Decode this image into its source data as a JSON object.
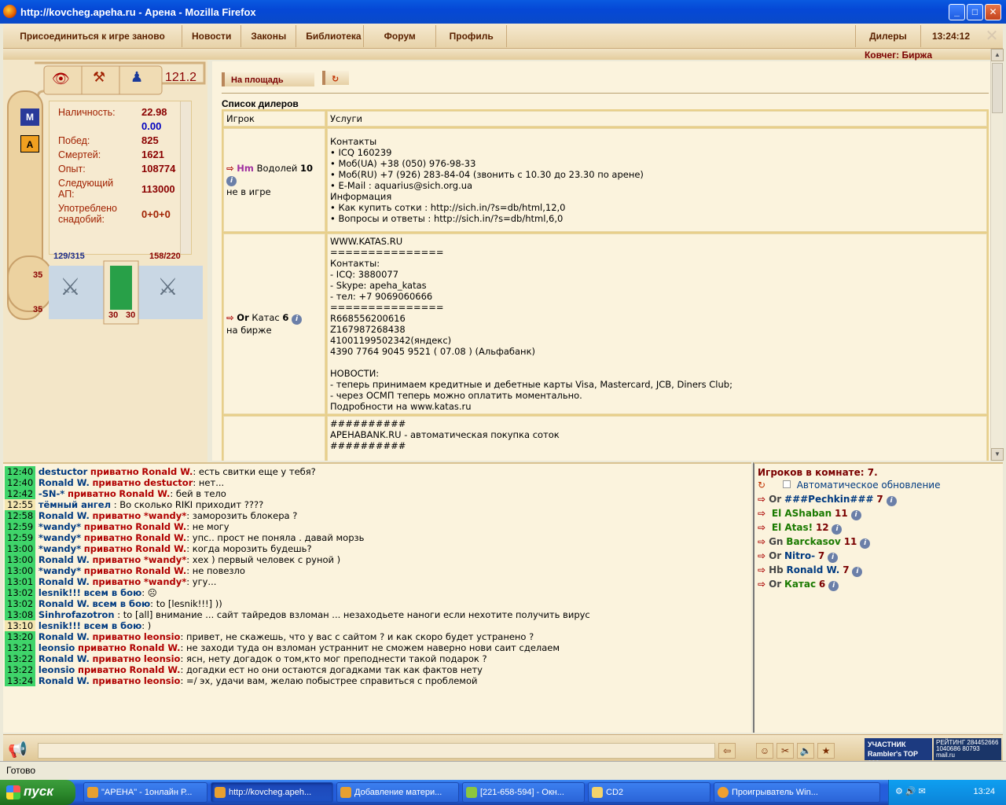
{
  "window": {
    "title": "http://kovcheg.apeha.ru - Арена - Mozilla Firefox",
    "buttons": {
      "minimize": "_",
      "maximize": "□",
      "close": "✕"
    }
  },
  "menu": {
    "items": [
      "Присоединиться к игре заново",
      "Новости",
      "Законы",
      "Библиотека",
      "Форум",
      "Профиль"
    ],
    "dealers": "Дилеры",
    "time": "13:24:12"
  },
  "location": "Ковчег: Биржа",
  "char": {
    "level": "121.2",
    "stats": [
      {
        "label": "Наличность:",
        "value": "22.98",
        "value2": "0.00"
      },
      {
        "label": "Побед:",
        "value": "825"
      },
      {
        "label": "Смертей:",
        "value": "1621"
      },
      {
        "label": "Опыт:",
        "value": "108774"
      },
      {
        "label": "Следующий АП:",
        "value": "113000"
      },
      {
        "label": "Употреблено снадобий:",
        "value": "0+0+0"
      }
    ],
    "hp": "129/315",
    "mp": "158/220",
    "slots": [
      "35",
      "35",
      "30",
      "30"
    ],
    "side_icons": [
      "M",
      "A"
    ]
  },
  "panel": {
    "button_square": "На площадь",
    "refresh": "↻",
    "list_title": "Список дилеров",
    "col_player": "Игрок",
    "col_services": "Услуги"
  },
  "dealers": [
    {
      "clan": "Hm",
      "name": "Водолей",
      "level": "10",
      "status": "не в игре",
      "services": [
        "Контакты",
        "• ICQ 160239",
        "• Моб(UA) +38 (050) 976-98-33",
        "• Моб(RU) +7 (926) 283-84-04 (звонить с 10.30 до 23.30 по арене)",
        "• E-Mail : aquarius@sich.org.ua",
        "Информация",
        "• Как купить сотки : http://sich.in/?s=db/html,12,0",
        "• Вопросы и ответы : http://sich.in/?s=db/html,6,0"
      ]
    },
    {
      "clan": "Or",
      "name": "Катас",
      "level": "6",
      "status": "на бирже",
      "services": [
        "WWW.KATAS.RU",
        "===============",
        "Контакты:",
        "- ICQ: 3880077",
        "- Skype: apeha_katas",
        "- тел: +7 9069060666",
        "===============",
        "R668556200616",
        "Z167987268438",
        "41001199502342(яндекс)",
        "4390 7764 9045 9521 ( 07.08 ) (Альфабанк)",
        "",
        "НОВОСТИ:",
        "- теперь принимаем кредитные и дебетные карты Visa, Mastercard, JCB, Diners Club;",
        "- через ОСМП теперь можно оплатить моментально.",
        "Подробности на www.katas.ru"
      ]
    },
    {
      "clan": "",
      "name": "",
      "level": "",
      "status": "",
      "services": [
        "##########",
        "APEHABANK.RU - автоматическая покупка соток",
        "##########"
      ]
    }
  ],
  "chat": [
    {
      "t": "12:40",
      "from": "destuctor",
      "priv": "приватно",
      "to": "Ronald W.",
      "msg": ": есть свитки еще у тебя?"
    },
    {
      "t": "12:40",
      "from": "Ronald W.",
      "priv": "приватно",
      "to": "destuctor",
      "msg": ": нет..."
    },
    {
      "t": "12:42",
      "from": "-SN-*",
      "priv": "приватно",
      "to": "Ronald W.",
      "msg": ": бей в тело"
    },
    {
      "t": "12:55",
      "from": "тёмный ангел",
      "priv": "",
      "to": "",
      "msg": ": Во сколько RIKI приходит ????"
    },
    {
      "t": "12:58",
      "from": "Ronald W.",
      "priv": "приватно",
      "to": "*wandy*",
      "msg": ": заморозить блокера ?"
    },
    {
      "t": "12:59",
      "from": "*wandy*",
      "priv": "приватно",
      "to": "Ronald W.",
      "msg": ": не могу"
    },
    {
      "t": "12:59",
      "from": "*wandy*",
      "priv": "приватно",
      "to": "Ronald W.",
      "msg": ": упс.. прост не поняла . давай морзь"
    },
    {
      "t": "13:00",
      "from": "*wandy*",
      "priv": "приватно",
      "to": "Ronald W.",
      "msg": ": когда морозить будешь?"
    },
    {
      "t": "13:00",
      "from": "Ronald W.",
      "priv": "приватно",
      "to": "*wandy*",
      "msg": ": хех ) первый человек с руной )"
    },
    {
      "t": "13:00",
      "from": "*wandy*",
      "priv": "приватно",
      "to": "Ronald W.",
      "msg": ": не повезло"
    },
    {
      "t": "13:01",
      "from": "Ronald W.",
      "priv": "приватно",
      "to": "*wandy*",
      "msg": ": угу..."
    },
    {
      "t": "13:02",
      "from": "lesnik!!!",
      "priv": "",
      "to": "всем в бою",
      "msg": ": ☹"
    },
    {
      "t": "13:02",
      "from": "Ronald W.",
      "priv": "",
      "to": "всем в бою",
      "msg": ": to [lesnik!!!] ))"
    },
    {
      "t": "13:08",
      "from": "Sinhrofazotron",
      "priv": "",
      "to": "",
      "msg": ": to [all] внимание ... сайт тайредов взломан ... незаходьете наноги если нехотите получить вирус"
    },
    {
      "t": "13:10",
      "from": "lesnik!!!",
      "priv": "",
      "to": "всем в бою",
      "msg": ": )"
    },
    {
      "t": "13:20",
      "from": "Ronald W.",
      "priv": "приватно",
      "to": "leonsio",
      "msg": ": привет, не скажешь, что у вас с сайтом ? и как скоро будет устранено ?"
    },
    {
      "t": "13:21",
      "from": "leonsio",
      "priv": "приватно",
      "to": "Ronald W.",
      "msg": ": не заходи туда он взломан устраннит не сможем наверно нови саит сделаем"
    },
    {
      "t": "13:22",
      "from": "Ronald W.",
      "priv": "приватно",
      "to": "leonsio",
      "msg": ": ясн, нету догадок о том,кто мог преподнести такой подарок ?"
    },
    {
      "t": "13:22",
      "from": "leonsio",
      "priv": "приватно",
      "to": "Ronald W.",
      "msg": ": догадки ест но они остаются догадками так как фактов нету"
    },
    {
      "t": "13:24",
      "from": "Ronald W.",
      "priv": "приватно",
      "to": "leonsio",
      "msg": ": =/ эх, удачи вам, желаю побыстрее справиться с проблемой"
    }
  ],
  "room": {
    "header": "Игроков в комнате: 7.",
    "auto_update": "Автоматическое обновление",
    "players": [
      {
        "clan": "Or",
        "name": "###Pechkin###",
        "level": "7",
        "color": "#003a80"
      },
      {
        "clan": "",
        "name": "El AShaban",
        "level": "11",
        "color": "#1a7a00"
      },
      {
        "clan": "",
        "name": "El Atas!",
        "level": "12",
        "color": "#1a7a00"
      },
      {
        "clan": "Gn",
        "name": "Barckasov",
        "level": "11",
        "color": "#1a7a00"
      },
      {
        "clan": "Or",
        "name": "Nitro-",
        "level": "7",
        "color": "#003a80"
      },
      {
        "clan": "Hb",
        "name": "Ronald W.",
        "level": "7",
        "color": "#003a80"
      },
      {
        "clan": "Or",
        "name": "Катас",
        "level": "6",
        "color": "#1a7a00"
      }
    ]
  },
  "status": "Готово",
  "badges": {
    "rambler": "УЧАСТНИК Rambler's TOP 100",
    "mail": "РЕЙТИНГ 284452666 1040686 80793 mail.ru"
  },
  "taskbar": {
    "start": "пуск",
    "tasks": [
      "\"АРЕНА\" - 1онлайн Р...",
      "http://kovcheg.apeh...",
      "Добавление матери...",
      "[221-658-594] - Окн...",
      "CD2",
      "Проигрыватель Win..."
    ],
    "lang": "RU",
    "clock": "13:24"
  }
}
